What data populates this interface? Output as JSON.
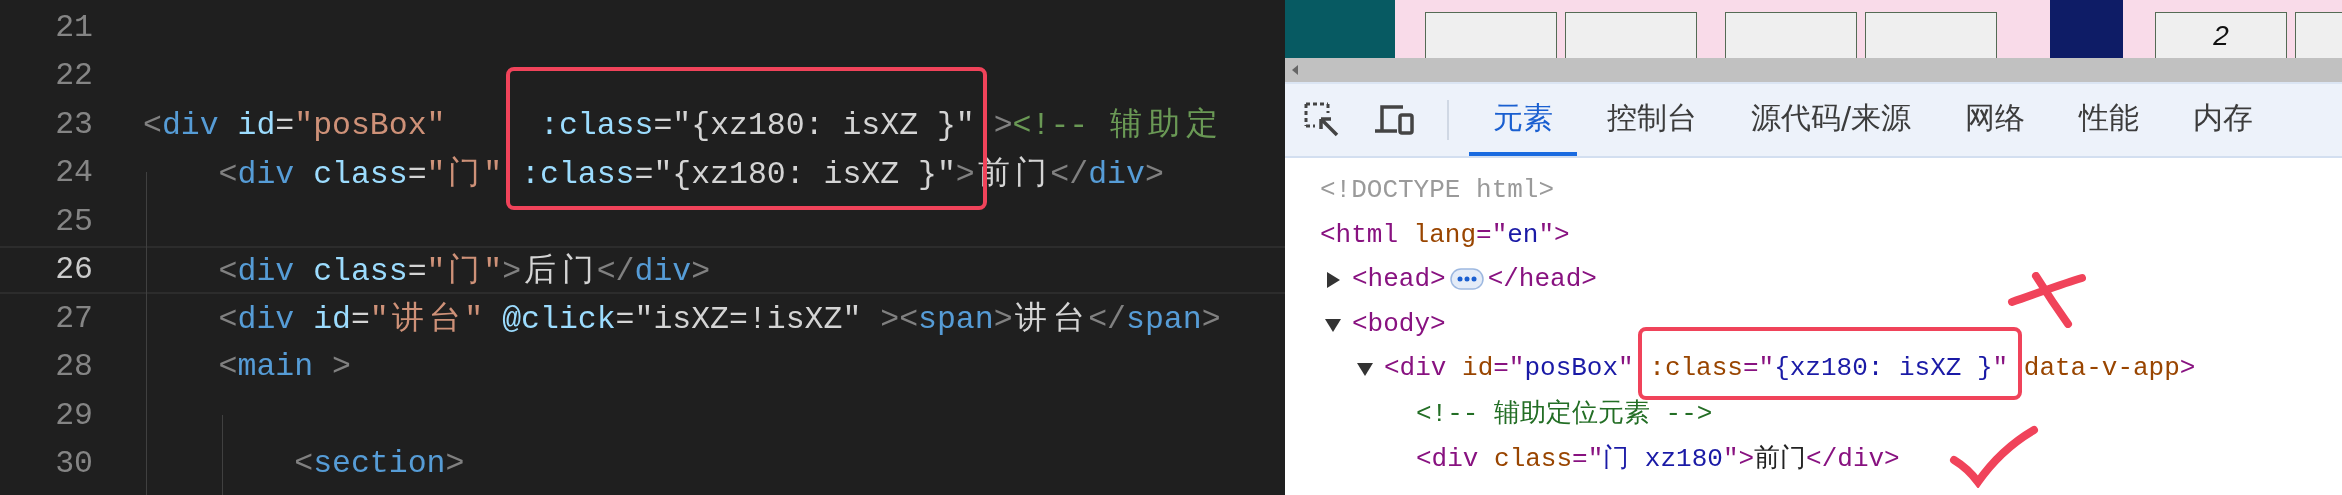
{
  "editor": {
    "lines": [
      {
        "number": "21",
        "current": false
      },
      {
        "number": "22",
        "current": false
      },
      {
        "number": "23",
        "current": false,
        "tokens": [
          {
            "kind": "punct",
            "text": "<"
          },
          {
            "kind": "tag",
            "text": "div"
          },
          {
            "kind": "attr",
            "text": " id"
          },
          {
            "kind": "plain",
            "text": "="
          },
          {
            "kind": "string",
            "text": "\"posBox\""
          },
          {
            "kind": "attr",
            "text": "     :class"
          },
          {
            "kind": "plain",
            "text": "=\"{xz180: isXZ }\" "
          },
          {
            "kind": "punct",
            "text": ">"
          },
          {
            "kind": "comment",
            "text": "<!-- 辅助定"
          }
        ]
      },
      {
        "number": "24",
        "current": false,
        "tokens": [
          {
            "kind": "punct",
            "text": "    <"
          },
          {
            "kind": "tag",
            "text": "div"
          },
          {
            "kind": "attr",
            "text": " class"
          },
          {
            "kind": "plain",
            "text": "="
          },
          {
            "kind": "string",
            "text": "\"门\""
          },
          {
            "kind": "attr",
            "text": " :class"
          },
          {
            "kind": "plain",
            "text": "=\"{xz180: isXZ }\""
          },
          {
            "kind": "punct",
            "text": ">"
          },
          {
            "kind": "plain",
            "text": "前门"
          },
          {
            "kind": "punct",
            "text": "</"
          },
          {
            "kind": "tag",
            "text": "div"
          },
          {
            "kind": "punct",
            "text": ">"
          }
        ]
      },
      {
        "number": "25",
        "current": false
      },
      {
        "number": "26",
        "current": true,
        "tokens": [
          {
            "kind": "punct",
            "text": "    <"
          },
          {
            "kind": "tag",
            "text": "div"
          },
          {
            "kind": "attr",
            "text": " class"
          },
          {
            "kind": "plain",
            "text": "="
          },
          {
            "kind": "string",
            "text": "\"门\""
          },
          {
            "kind": "punct",
            "text": ">"
          },
          {
            "kind": "plain",
            "text": "后门"
          },
          {
            "kind": "punct",
            "text": "</"
          },
          {
            "kind": "tag",
            "text": "div"
          },
          {
            "kind": "punct",
            "text": ">"
          }
        ]
      },
      {
        "number": "27",
        "current": false,
        "tokens": [
          {
            "kind": "punct",
            "text": "    <"
          },
          {
            "kind": "tag",
            "text": "div"
          },
          {
            "kind": "attr",
            "text": " id"
          },
          {
            "kind": "plain",
            "text": "="
          },
          {
            "kind": "string",
            "text": "\"讲台\""
          },
          {
            "kind": "attr",
            "text": " @click"
          },
          {
            "kind": "plain",
            "text": "=\"isXZ=!isXZ\" "
          },
          {
            "kind": "punct",
            "text": "><"
          },
          {
            "kind": "tag",
            "text": "span"
          },
          {
            "kind": "punct",
            "text": ">"
          },
          {
            "kind": "plain",
            "text": "讲台"
          },
          {
            "kind": "punct",
            "text": "</"
          },
          {
            "kind": "tag",
            "text": "span"
          },
          {
            "kind": "punct",
            "text": ">"
          }
        ]
      },
      {
        "number": "28",
        "current": false,
        "tokens": [
          {
            "kind": "punct",
            "text": "    <"
          },
          {
            "kind": "tag",
            "text": "main"
          },
          {
            "kind": "punct",
            "text": " >"
          }
        ]
      },
      {
        "number": "29",
        "current": false
      },
      {
        "number": "30",
        "current": false,
        "tokens": [
          {
            "kind": "punct",
            "text": "        <"
          },
          {
            "kind": "tag",
            "text": "section"
          },
          {
            "kind": "punct",
            "text": ">"
          }
        ]
      }
    ]
  },
  "preview": {
    "cell_text": "2"
  },
  "devtools": {
    "tabs": [
      {
        "label": "元素",
        "selected": true
      },
      {
        "label": "控制台",
        "selected": false
      },
      {
        "label": "源代码/来源",
        "selected": false
      },
      {
        "label": "网络",
        "selected": false
      },
      {
        "label": "性能",
        "selected": false
      },
      {
        "label": "内存",
        "selected": false
      }
    ],
    "dom_tree": [
      {
        "tokens": [
          {
            "kind": "doctype",
            "text": "<!DOCTYPE html>"
          }
        ]
      },
      {
        "tokens": [
          {
            "kind": "tag",
            "text": "<html"
          },
          {
            "kind": "attr",
            "text": " lang"
          },
          {
            "kind": "tag",
            "text": "=\""
          },
          {
            "kind": "value",
            "text": "en"
          },
          {
            "kind": "tag",
            "text": "\">"
          }
        ],
        "children": [
          {
            "tokens": [
              {
                "kind": "tag",
                "text": "<head>"
              }
            ],
            "expanded": false,
            "close": [
              {
                "kind": "tag",
                "text": "</head>"
              }
            ]
          },
          {
            "tokens": [
              {
                "kind": "tag",
                "text": "<body>"
              }
            ],
            "expanded": true,
            "children": [
              {
                "tokens": [
                  {
                    "kind": "tag",
                    "text": "<div"
                  },
                  {
                    "kind": "attr",
                    "text": " id"
                  },
                  {
                    "kind": "tag",
                    "text": "=\""
                  },
                  {
                    "kind": "value",
                    "text": "posBox"
                  },
                  {
                    "kind": "tag",
                    "text": "\""
                  },
                  {
                    "kind": "attr",
                    "text": " :class"
                  },
                  {
                    "kind": "tag",
                    "text": "=\""
                  },
                  {
                    "kind": "value",
                    "text": "{xz180: isXZ }"
                  },
                  {
                    "kind": "tag",
                    "text": "\""
                  },
                  {
                    "kind": "attr",
                    "text": " data-v-app"
                  },
                  {
                    "kind": "tag",
                    "text": ">"
                  }
                ],
                "expanded": true,
                "children": [
                  {
                    "tokens": [
                      {
                        "kind": "comment",
                        "text": "<!-- 辅助定位元素 -->"
                      }
                    ]
                  },
                  {
                    "tokens": [
                      {
                        "kind": "tag",
                        "text": "<div"
                      },
                      {
                        "kind": "attr",
                        "text": " class"
                      },
                      {
                        "kind": "tag",
                        "text": "=\""
                      },
                      {
                        "kind": "value",
                        "text": "门 xz180"
                      },
                      {
                        "kind": "tag",
                        "text": "\">"
                      },
                      {
                        "kind": "text",
                        "text": "前门"
                      },
                      {
                        "kind": "tag",
                        "text": "</div>"
                      }
                    ]
                  }
                ]
              }
            ]
          }
        ]
      }
    ]
  }
}
